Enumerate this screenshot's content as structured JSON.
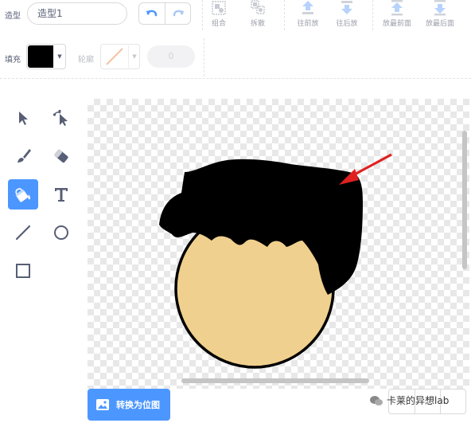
{
  "toolbar": {
    "costume_label": "造型",
    "costume_name": "造型1",
    "group_label": "组合",
    "ungroup_label": "拆散",
    "forward_label": "往前放",
    "backward_label": "往后放",
    "front_label": "放最前面",
    "back_label": "放最后面",
    "fill_label": "填充",
    "fill_color": "#000000",
    "outline_label": "轮廓",
    "outline_width": "0"
  },
  "tools": [
    "select-tool",
    "reshape-tool",
    "brush-tool",
    "eraser-tool",
    "fill-tool",
    "text-tool",
    "line-tool",
    "circle-tool",
    "rectangle-tool"
  ],
  "active_tool": "fill-tool",
  "canvas": {
    "face_color": "#f0d08e",
    "hair_color": "#000000",
    "arrow_color": "#e02020"
  },
  "footer": {
    "convert_button": "转换为位图",
    "watermark": "卡莱的异想lab"
  },
  "colors": {
    "accent": "#4c97ff",
    "text": "#575e75"
  }
}
